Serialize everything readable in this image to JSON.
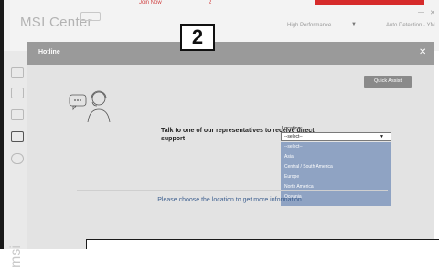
{
  "app": {
    "title": "MSI Center",
    "badge": "",
    "mode_label": "High Performance",
    "mode_caret": "▼",
    "user_label": "Auto Detection · YM",
    "window_minimize": "—",
    "window_close": "✕"
  },
  "background": {
    "link_left": "Join Now",
    "link_right": "2"
  },
  "callout": {
    "label": "2"
  },
  "sidebar": {
    "watermark": "msi",
    "icons": [
      "home-icon",
      "device-icon",
      "eco-icon",
      "performance-icon",
      "settings-icon"
    ]
  },
  "modal": {
    "title": "Hotline",
    "close": "✕",
    "quick_assist_label": "Quick Assist",
    "support_text": "Talk to one of our representatives to receive direct support",
    "location": {
      "label": "Location",
      "selected": "--select--",
      "caret": "▼",
      "options": [
        "--select--",
        "Asia",
        "Central / South America",
        "Europe",
        "North America",
        "Oceania"
      ]
    },
    "info_text": "Please choose the location to get more information."
  },
  "colors": {
    "header_bg": "#9a9a9a",
    "dropdown_bg": "#8fa3c3",
    "quick_assist_bg": "#8a8a8a",
    "info_text": "#3d5f8f",
    "accent_red": "#d62b2b"
  }
}
